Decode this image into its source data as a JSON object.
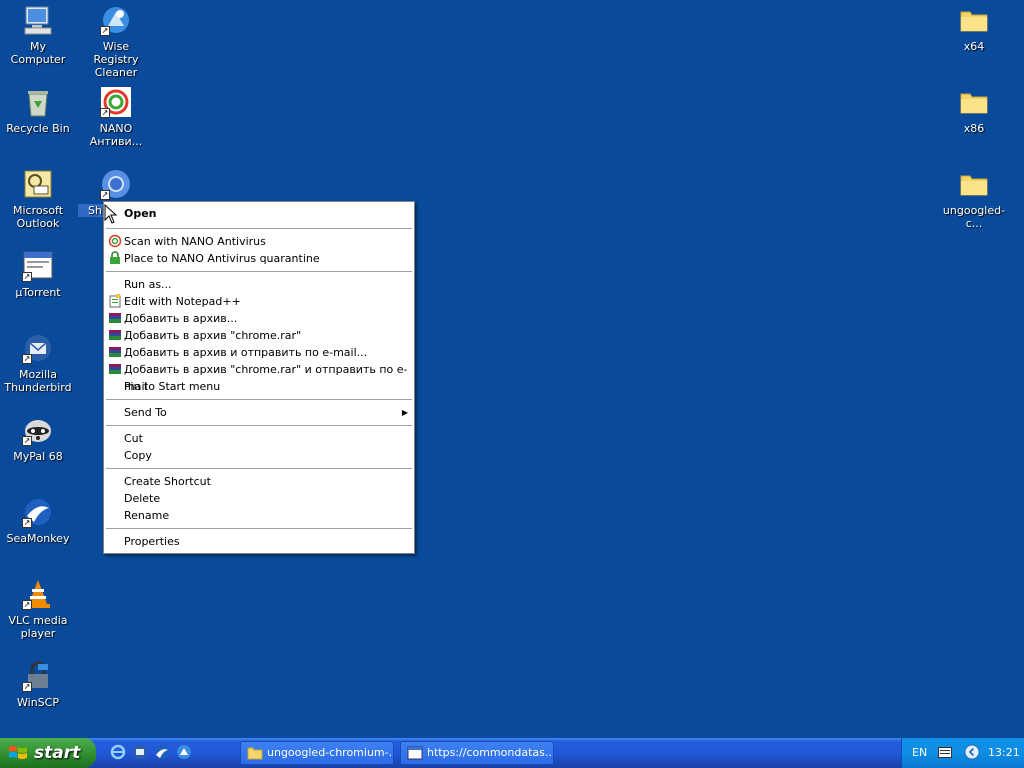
{
  "desktop": {
    "icons": [
      {
        "name": "my-computer",
        "label": "My Computer"
      },
      {
        "name": "wise-registry-cleaner",
        "label": "Wise Registry Cleaner"
      },
      {
        "name": "recycle-bin",
        "label": "Recycle Bin"
      },
      {
        "name": "nano-antivirus",
        "label": "NANO Антиви..."
      },
      {
        "name": "microsoft-outlook",
        "label": "Microsoft Outlook"
      },
      {
        "name": "shortcut-chromium",
        "label": "Sh chr"
      },
      {
        "name": "utorrent",
        "label": "µTorrent"
      },
      {
        "name": "mozilla-thunderbird",
        "label": "Mozilla Thunderbird"
      },
      {
        "name": "mypal-68",
        "label": "MyPal 68"
      },
      {
        "name": "seamonkey",
        "label": "SeaMonkey"
      },
      {
        "name": "vlc-media-player",
        "label": "VLC media player"
      },
      {
        "name": "winscp",
        "label": "WinSCP"
      },
      {
        "name": "folder-x64",
        "label": "x64"
      },
      {
        "name": "folder-x86",
        "label": "x86"
      },
      {
        "name": "folder-ungoogled",
        "label": "ungoogled-c..."
      }
    ]
  },
  "context_menu": {
    "items": [
      {
        "label": "Open"
      },
      {
        "label": "Scan with NANO Antivirus"
      },
      {
        "label": "Place to NANO Antivirus quarantine"
      },
      {
        "label": "Run as..."
      },
      {
        "label": "Edit with Notepad++"
      },
      {
        "label": "Добавить в архив..."
      },
      {
        "label": "Добавить в архив \"chrome.rar\""
      },
      {
        "label": "Добавить в архив и отправить по e-mail..."
      },
      {
        "label": "Добавить в архив \"chrome.rar\" и отправить по e-mail"
      },
      {
        "label": "Pin to Start menu"
      },
      {
        "label": "Send To"
      },
      {
        "label": "Cut"
      },
      {
        "label": "Copy"
      },
      {
        "label": "Create Shortcut"
      },
      {
        "label": "Delete"
      },
      {
        "label": "Rename"
      },
      {
        "label": "Properties"
      }
    ]
  },
  "taskbar": {
    "start_label": "start",
    "tasks": [
      {
        "label": "ungoogled-chromium-..."
      },
      {
        "label": "https://commondatas..."
      }
    ],
    "tray": {
      "lang": "EN",
      "clock": "13:21"
    }
  },
  "colors": {
    "desktop": "#0a4a9b",
    "selection": "#316ac5",
    "taskbar": "#245edb",
    "start": "#2e8b2e"
  }
}
